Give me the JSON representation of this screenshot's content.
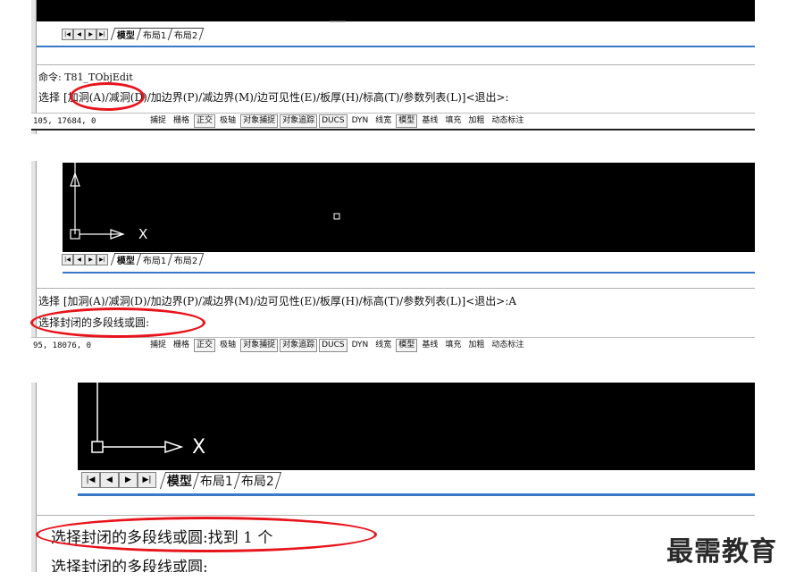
{
  "panel1": {
    "layout_tabs": {
      "nav": [
        "|◀",
        "◀",
        "▶",
        "▶|"
      ],
      "model": "模型",
      "layout1": "布局1",
      "layout2": "布局2"
    },
    "command_history": "命令: T81_TObjEdit",
    "prompt": {
      "prefix": "选择",
      "add_hole": "[加洞(A)",
      "rest": "/减洞(D)/加边界(P)/减边界(M)/边可见性(E)/板厚(H)/标高(T)/参数列表(L)]<退出>:"
    },
    "status_coords": "105, 17684, 0"
  },
  "panel2": {
    "axis_x_label": "X",
    "layout_tabs": {
      "nav": [
        "|◀",
        "◀",
        "▶",
        "▶|"
      ],
      "model": "模型",
      "layout1": "布局1",
      "layout2": "布局2"
    },
    "command_history": "选择 [加洞(A)/减洞(D)/加边界(P)/减边界(M)/边可见性(E)/板厚(H)/标高(T)/参数列表(L)]<退出>:A",
    "prompt": "选择封闭的多段线或圆:",
    "status_coords": "95, 18076, 0"
  },
  "panel3": {
    "axis_x_label": "X",
    "layout_tabs": {
      "nav": [
        "|◀",
        "◀",
        "▶",
        "▶|"
      ],
      "model": "模型",
      "layout1": "布局1",
      "layout2": "布局2"
    },
    "result_line": "选择封闭的多段线或圆:找到 1 个",
    "prompt": "选择封闭的多段线或圆:"
  },
  "status_buttons": [
    "捕捉",
    "栅格",
    "正交",
    "极轴",
    "对象捕捉",
    "对象追踪",
    "DUCS",
    "DYN",
    "线宽",
    "模型",
    "基线",
    "填充",
    "加粗",
    "动态标注"
  ],
  "watermark": "最需教育",
  "colors": {
    "canvas": "#000000",
    "highlight_ellipse": "#e8141c",
    "frame_line": "#3a78c8"
  }
}
